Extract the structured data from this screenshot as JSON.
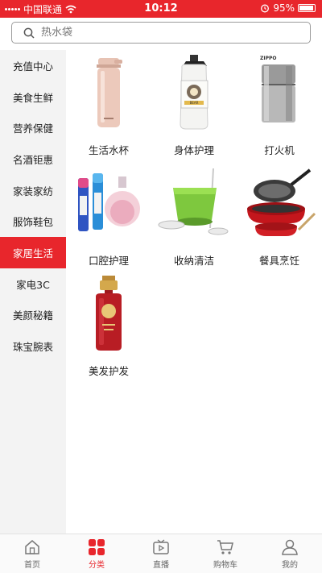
{
  "status_bar": {
    "carrier": "中国联通",
    "time": "10:12",
    "battery": "95%"
  },
  "search": {
    "placeholder": "热水袋"
  },
  "sidebar": {
    "items": [
      {
        "label": "充值中心"
      },
      {
        "label": "美食生鲜"
      },
      {
        "label": "营养保健"
      },
      {
        "label": "名酒钜惠"
      },
      {
        "label": "家装家纺"
      },
      {
        "label": "服饰鞋包"
      },
      {
        "label": "家居生活"
      },
      {
        "label": "家电3C"
      },
      {
        "label": "美颜秘籍"
      },
      {
        "label": "珠宝腕表"
      }
    ],
    "active_label": "家居生活"
  },
  "products": {
    "items": [
      {
        "label": "生活水杯",
        "icon": "thermos-cup-image"
      },
      {
        "label": "身体护理",
        "icon": "body-lotion-image",
        "product_text": "BEAR"
      },
      {
        "label": "打火机",
        "icon": "zippo-lighter-image",
        "product_text": "ZIPPO"
      },
      {
        "label": "口腔护理",
        "icon": "oral-care-image"
      },
      {
        "label": "收纳清洁",
        "icon": "mop-bucket-image"
      },
      {
        "label": "餐具烹饪",
        "icon": "cookware-set-image"
      },
      {
        "label": "美发护发",
        "icon": "shampoo-bottle-image"
      }
    ]
  },
  "tabbar": {
    "items": [
      {
        "label": "首页",
        "icon": "home-icon"
      },
      {
        "label": "分类",
        "icon": "category-icon"
      },
      {
        "label": "直播",
        "icon": "live-tv-icon"
      },
      {
        "label": "购物车",
        "icon": "cart-icon"
      },
      {
        "label": "我的",
        "icon": "profile-icon"
      }
    ],
    "active_label": "分类"
  },
  "colors": {
    "accent": "#e8262c",
    "sidebar_bg": "#f3f3f3"
  }
}
